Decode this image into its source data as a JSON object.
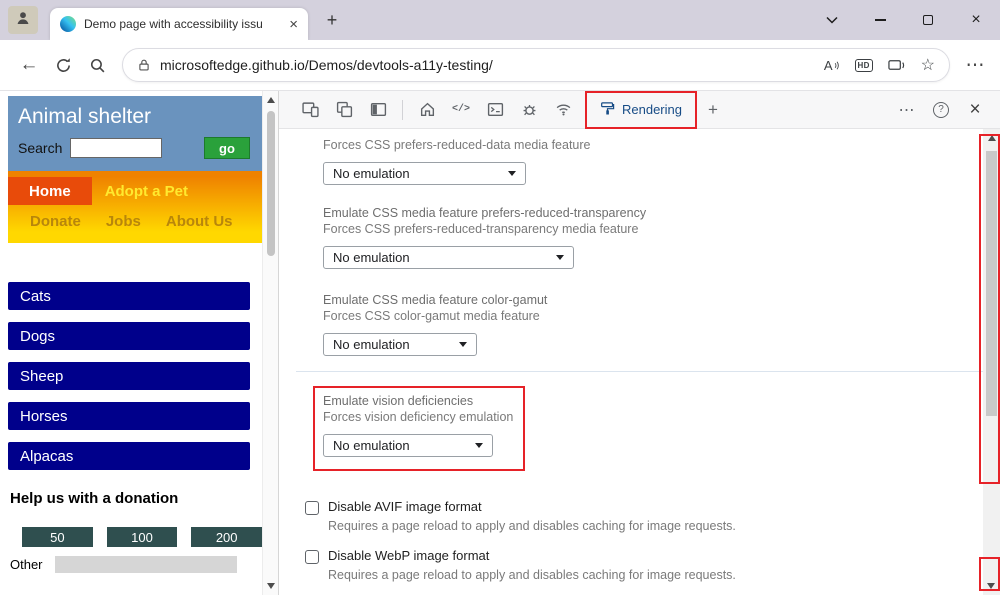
{
  "window": {
    "tab_title": "Demo page with accessibility issu",
    "url": "microsoftedge.github.io/Demos/devtools-a11y-testing/",
    "hd_badge": "HD"
  },
  "icons": {
    "back": "←",
    "star": "☆",
    "more": "⋯",
    "close": "×",
    "plus": "+",
    "help": "?",
    "read_aloud_letter": "A",
    "sources_glyph": "</>"
  },
  "page": {
    "title": "Animal shelter",
    "search_label": "Search",
    "go_button": "go",
    "nav": {
      "home": "Home",
      "adopt": "Adopt a Pet",
      "donate": "Donate",
      "jobs": "Jobs",
      "about": "About Us"
    },
    "animals": [
      "Cats",
      "Dogs",
      "Sheep",
      "Horses",
      "Alpacas"
    ],
    "donation": {
      "heading": "Help us with a donation",
      "amounts": [
        "50",
        "100",
        "200"
      ],
      "other_label": "Other"
    }
  },
  "devtools": {
    "rendering_tab": "Rendering",
    "sections": [
      {
        "description": "Forces CSS prefers-reduced-data media feature",
        "dropdown": "No emulation"
      },
      {
        "title": "Emulate CSS media feature prefers-reduced-transparency",
        "description": "Forces CSS prefers-reduced-transparency media feature",
        "dropdown": "No emulation"
      },
      {
        "title": "Emulate CSS media feature color-gamut",
        "description": "Forces CSS color-gamut media feature",
        "dropdown": "No emulation"
      },
      {
        "title": "Emulate vision deficiencies",
        "description": "Forces vision deficiency emulation",
        "dropdown": "No emulation"
      }
    ],
    "checkboxes": [
      {
        "label": "Disable AVIF image format",
        "description": "Requires a page reload to apply and disables caching for image requests."
      },
      {
        "label": "Disable WebP image format",
        "description": "Requires a page reload to apply and disables caching for image requests."
      }
    ]
  },
  "colors": {
    "annotation_red": "#e62228",
    "page_header_blue": "#6a93be",
    "animal_button_navy": "#00008b",
    "go_button_green": "#2aa13b",
    "donate_button_slate": "#2f4f4f",
    "nav_home_orange": "#e84b0a"
  }
}
